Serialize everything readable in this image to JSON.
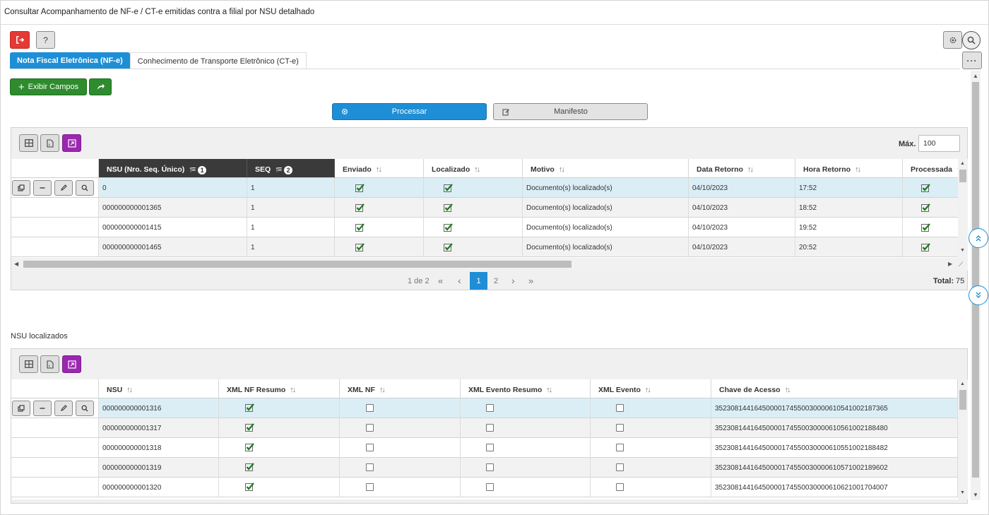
{
  "window_title": "Consultar Acompanhamento de NF-e / CT-e emitidas contra a filial por NSU detalhado",
  "tabs": [
    {
      "label": "Nota Fiscal Eletrônica (NF-e)",
      "active": true
    },
    {
      "label": "Conhecimento de Transporte Eletrônico (CT-e)",
      "active": false
    }
  ],
  "toolbar": {
    "exibir_campos_label": "Exibir Campos",
    "processar_label": "Processar",
    "manifesto_label": "Manifesto",
    "help_label": "?",
    "more_label": "···"
  },
  "grid1": {
    "max_label": "Máx.",
    "max_value": "100",
    "columns": [
      {
        "label": "NSU (Nro. Seq. Único)",
        "badge": "1"
      },
      {
        "label": "SEQ",
        "badge": "2"
      },
      {
        "label": "Enviado"
      },
      {
        "label": "Localizado"
      },
      {
        "label": "Motivo"
      },
      {
        "label": "Data Retorno"
      },
      {
        "label": "Hora Retorno"
      },
      {
        "label": "Processada"
      }
    ],
    "rows": [
      {
        "nsu": "0",
        "seq": "1",
        "motivo": "Documento(s) localizado(s)",
        "data": "04/10/2023",
        "hora": "17:52"
      },
      {
        "nsu": "000000000001365",
        "seq": "1",
        "motivo": "Documento(s) localizado(s)",
        "data": "04/10/2023",
        "hora": "18:52"
      },
      {
        "nsu": "000000000001415",
        "seq": "1",
        "motivo": "Documento(s) localizado(s)",
        "data": "04/10/2023",
        "hora": "19:52"
      },
      {
        "nsu": "000000000001465",
        "seq": "1",
        "motivo": "Documento(s) localizado(s)",
        "data": "04/10/2023",
        "hora": "20:52"
      }
    ],
    "pager": {
      "info": "1 de 2",
      "first": "«",
      "prev": "‹",
      "page1": "1",
      "page2": "2",
      "next": "›",
      "last": "»"
    },
    "total_label": "Total:",
    "total_value": "75"
  },
  "section2_title": "NSU localizados",
  "grid2": {
    "columns": [
      {
        "label": "NSU"
      },
      {
        "label": "XML NF Resumo"
      },
      {
        "label": "XML NF"
      },
      {
        "label": "XML Evento Resumo"
      },
      {
        "label": "XML Evento"
      },
      {
        "label": "Chave de Acesso"
      }
    ],
    "rows": [
      {
        "nsu": "000000000001316",
        "chave": "35230814416450000174550030000610541002187365"
      },
      {
        "nsu": "000000000001317",
        "chave": "35230814416450000174550030000610561002188480"
      },
      {
        "nsu": "000000000001318",
        "chave": "35230814416450000174550030000610551002188482"
      },
      {
        "nsu": "000000000001319",
        "chave": "35230814416450000174550030000610571002189602"
      },
      {
        "nsu": "000000000001320",
        "chave": "35230814416450000174550030000610621001704007"
      }
    ]
  },
  "colors": {
    "primary": "#1e8fd6",
    "green": "#2e8b2e",
    "red": "#e53935",
    "purple": "#9c27b0",
    "selected_row": "#dbeef6"
  }
}
